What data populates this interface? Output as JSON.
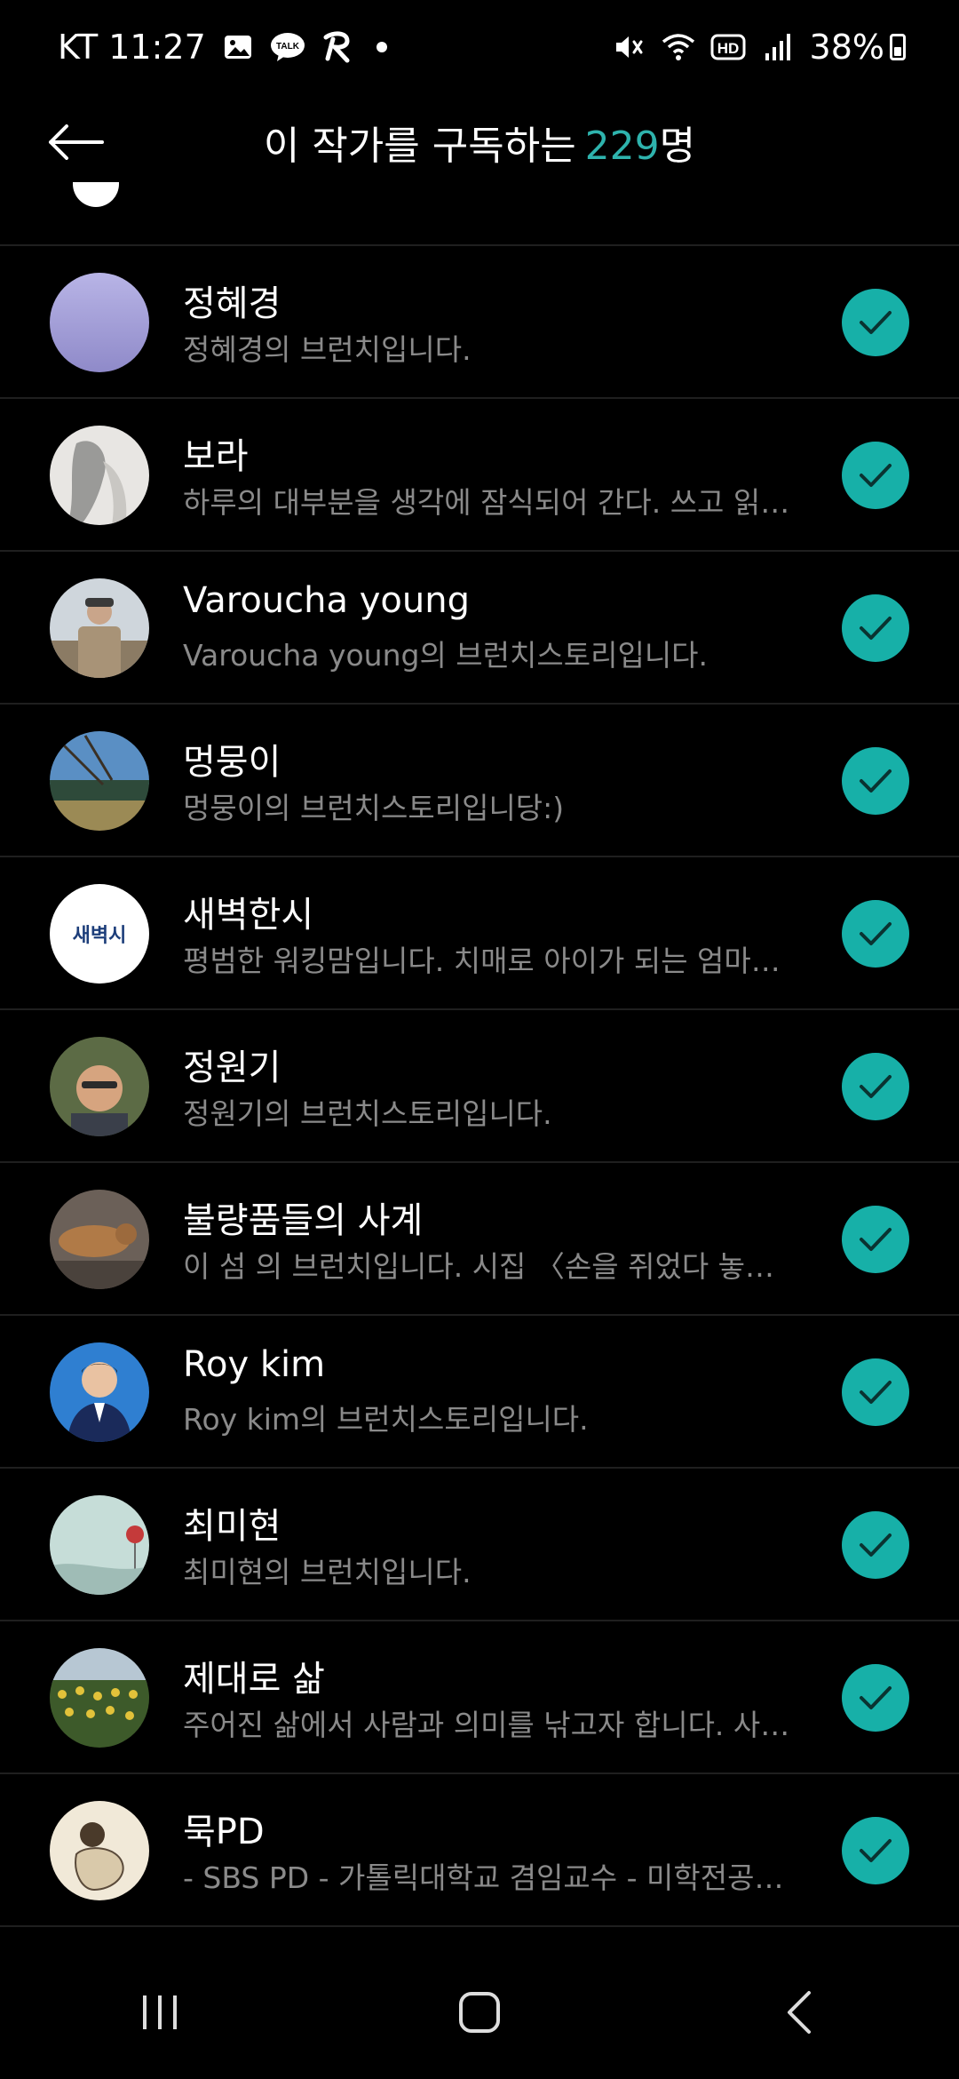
{
  "status_bar": {
    "carrier_time": "KT 11:27",
    "battery": "38%",
    "battery_level": 0.38,
    "icons_left": [
      "gallery-icon",
      "kakaotalk-icon",
      "app-r-icon",
      "notification-dot"
    ],
    "icons_right": [
      "mute-icon",
      "wifi-icon",
      "hd-icon",
      "signal-icon",
      "battery-icon"
    ]
  },
  "header": {
    "title_prefix": "이 작가를 구독하는",
    "count": "229",
    "title_suffix": "명"
  },
  "colors": {
    "accent": "#17b0a8",
    "count_text": "#2eb3ad",
    "background": "#000000",
    "secondary_text": "#8a8a8a"
  },
  "subscribers": [
    {
      "name": "정혜경",
      "desc": "정혜경의 브런치입니다.",
      "subscribed": true
    },
    {
      "name": "보라",
      "desc": "하루의 대부분을 생각에 잠식되어 간다. 쓰고 읽고…",
      "subscribed": true
    },
    {
      "name": "Varoucha young",
      "desc": "Varoucha young의 브런치스토리입니다.",
      "subscribed": true
    },
    {
      "name": "멍뭉이",
      "desc": "멍뭉이의 브런치스토리입니당:)",
      "subscribed": true
    },
    {
      "name": "새벽한시",
      "desc": "평범한 워킹맘입니다. 치매로 아이가 되는 엄마를…",
      "subscribed": true,
      "avatar_text": "새벽시"
    },
    {
      "name": "정원기",
      "desc": "정원기의 브런치스토리입니다.",
      "subscribed": true
    },
    {
      "name": "불량품들의 사계",
      "desc": "이 섬 의 브런치입니다. 시집 〈손을 쥐었다 놓으면〉…",
      "subscribed": true
    },
    {
      "name": "Roy kim",
      "desc": "Roy kim의 브런치스토리입니다.",
      "subscribed": true
    },
    {
      "name": "최미현",
      "desc": "최미현의 브런치입니다.",
      "subscribed": true
    },
    {
      "name": "제대로 삶",
      "desc": "주어진 삶에서 사람과 의미를 낚고자 합니다. 사라…",
      "subscribed": true
    },
    {
      "name": "묵PD",
      "desc": "- SBS PD - 가톨릭대학교 겸임교수 - 미학전공자…",
      "subscribed": true
    }
  ],
  "navbar": [
    "recents-icon",
    "home-icon",
    "back-icon"
  ]
}
